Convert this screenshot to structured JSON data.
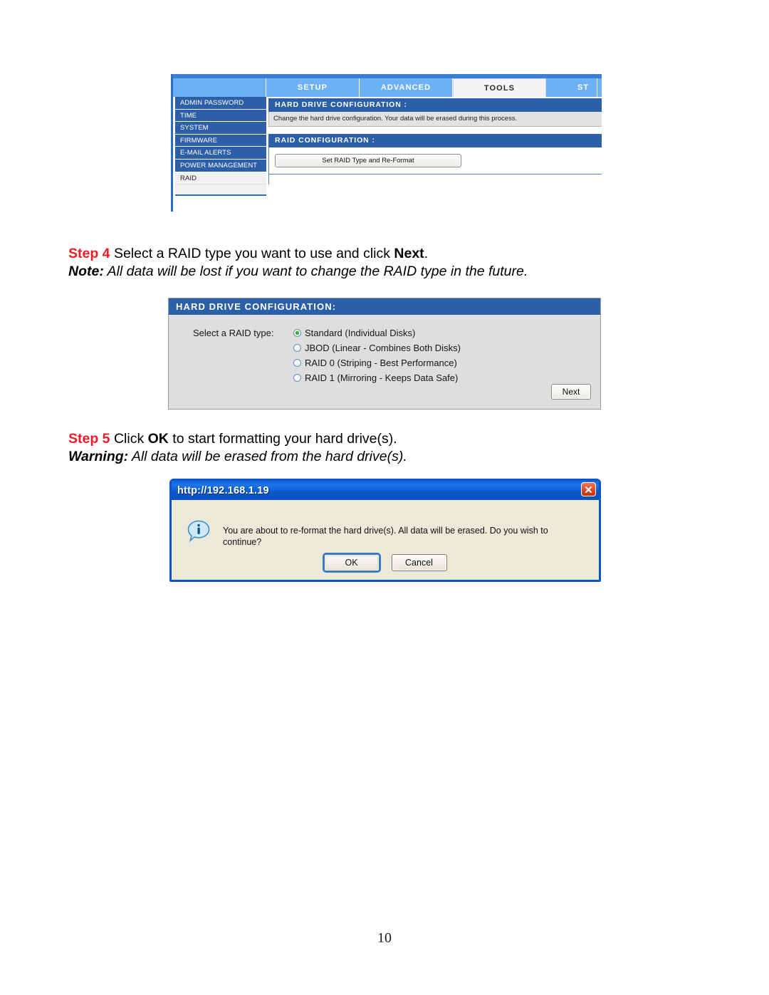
{
  "page": {
    "number": "10"
  },
  "screenshot1": {
    "name": "hard-drive-configuration-tools-page",
    "tabs": [
      {
        "label": "",
        "active": false
      },
      {
        "label": "SETUP",
        "active": false
      },
      {
        "label": "ADVANCED",
        "active": false
      },
      {
        "label": "TOOLS",
        "active": true
      },
      {
        "label": "ST",
        "active": false
      }
    ],
    "sidebar": [
      {
        "label": "ADMIN PASSWORD",
        "selected": false
      },
      {
        "label": "TIME",
        "selected": false
      },
      {
        "label": "SYSTEM",
        "selected": false
      },
      {
        "label": "FIRMWARE",
        "selected": false
      },
      {
        "label": "E-MAIL ALERTS",
        "selected": false
      },
      {
        "label": "POWER MANAGEMENT",
        "selected": false
      },
      {
        "label": "RAID",
        "selected": true
      }
    ],
    "hard_drive_panel": {
      "header": "HARD DRIVE CONFIGURATION :",
      "description": "Change the hard drive configuration. Your data will be erased during this process."
    },
    "raid_panel": {
      "header": "RAID CONFIGURATION :",
      "button_label": "Set RAID Type and Re-Format"
    }
  },
  "step4": {
    "label": "Step 4",
    "text_before": " Select a RAID type you want to use and click ",
    "bold_word": "Next",
    "text_after": ".",
    "note_label": "Note:",
    "note_text": " All data will be lost if you want to change the RAID type in the future."
  },
  "screenshot2": {
    "name": "raid-type-selection-panel",
    "header": "HARD DRIVE CONFIGURATION:",
    "select_label": "Select a RAID type:",
    "options": [
      {
        "label": "Standard (Individual Disks)",
        "selected": true
      },
      {
        "label": "JBOD (Linear - Combines Both Disks)",
        "selected": false
      },
      {
        "label": "RAID 0 (Striping - Best Performance)",
        "selected": false
      },
      {
        "label": "RAID 1 (Mirroring - Keeps Data Safe)",
        "selected": false
      }
    ],
    "next_button": "Next"
  },
  "step5": {
    "label": "Step 5",
    "text_before": " Click ",
    "bold_word": "OK",
    "text_after": " to start formatting your hard drive(s).",
    "warning_label": "Warning:",
    "warning_text": " All data will be erased from the hard drive(s)."
  },
  "dialog": {
    "name": "reformat-confirm-dialog",
    "title": "http://192.168.1.19",
    "message": "You are about to re-format the hard drive(s). All data will be erased. Do you wish to continue?",
    "ok_label": "OK",
    "cancel_label": "Cancel"
  },
  "colors": {
    "step_red": "#ee1c25",
    "panel_header_blue": "#2b5fa8",
    "tab_blue": "#6cb0f5",
    "sidebar_blue": "#2c5fa8",
    "dialog_title_blue": "#0f62d6",
    "dialog_face": "#ece9d8",
    "radio_green": "#25b925",
    "close_red": "#c32d11"
  }
}
